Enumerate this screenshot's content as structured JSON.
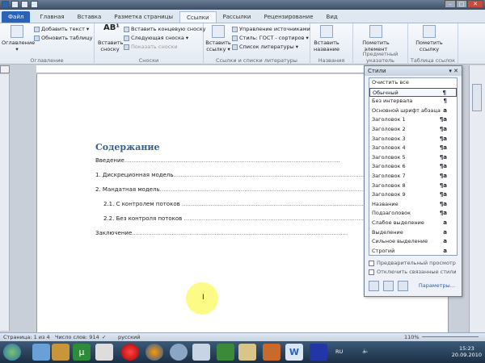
{
  "tabs": [
    "Файл",
    "Главная",
    "Вставка",
    "Разметка страницы",
    "Ссылки",
    "Рассылки",
    "Рецензирование",
    "Вид"
  ],
  "active_tab": "Ссылки",
  "ribbon": {
    "toc_group": {
      "label": "Оглавление",
      "big": "Оглавление",
      "add_text": "Добавить текст",
      "update_table": "Обновить таблицу"
    },
    "footnotes_group": {
      "label": "Сноски",
      "big": "Вставить сноску",
      "endnote": "Вставить концевую сноску",
      "next": "Следующая сноска",
      "show": "Показать сноски"
    },
    "citations_group": {
      "label": "Ссылки и списки литературы",
      "big": "Вставить ссылку",
      "manage": "Управление источниками",
      "style_label": "Стиль:",
      "style_value": "ГОСТ - сортиров",
      "bibliography": "Список литературы"
    },
    "captions_group": {
      "label": "Названия",
      "big": "Вставить название"
    },
    "index_group": {
      "label": "Предметный указатель",
      "big": "Пометить элемент"
    },
    "toa_group": {
      "label": "Таблица ссылок",
      "big": "Пометить ссылку"
    }
  },
  "document": {
    "title": "Содержание",
    "toc": [
      {
        "text": "Введение",
        "level": 1
      },
      {
        "text": "1. Дискреционная модель",
        "level": 1
      },
      {
        "text": "2. Мандатная модель",
        "level": 1
      },
      {
        "text": "2.1. С контролем потоков",
        "level": 2
      },
      {
        "text": "2.2. Без контроля потоков",
        "level": 2
      },
      {
        "text": "Заключение",
        "level": 1
      }
    ]
  },
  "styles_pane": {
    "title": "Стили",
    "items": [
      {
        "name": "Очистить все",
        "mark": ""
      },
      {
        "name": "Обычный",
        "mark": "¶",
        "selected": true
      },
      {
        "name": "Без интервала",
        "mark": "¶"
      },
      {
        "name": "Основной шрифт абзаца",
        "mark": "a"
      },
      {
        "name": "Заголовок 1",
        "mark": "¶a"
      },
      {
        "name": "Заголовок 2",
        "mark": "¶a"
      },
      {
        "name": "Заголовок 3",
        "mark": "¶a"
      },
      {
        "name": "Заголовок 4",
        "mark": "¶a"
      },
      {
        "name": "Заголовок 5",
        "mark": "¶a"
      },
      {
        "name": "Заголовок 6",
        "mark": "¶a"
      },
      {
        "name": "Заголовок 7",
        "mark": "¶a"
      },
      {
        "name": "Заголовок 8",
        "mark": "¶a"
      },
      {
        "name": "Заголовок 9",
        "mark": "¶a"
      },
      {
        "name": "Название",
        "mark": "¶a"
      },
      {
        "name": "Подзаголовок",
        "mark": "¶a"
      },
      {
        "name": "Слабое выделение",
        "mark": "a"
      },
      {
        "name": "Выделение",
        "mark": "a"
      },
      {
        "name": "Сильное выделение",
        "mark": "a"
      },
      {
        "name": "Строгий",
        "mark": "a"
      }
    ],
    "preview_label": "Предварительный просмотр",
    "linked_label": "Отключить связанные стили",
    "options_link": "Параметры..."
  },
  "status": {
    "page": "Страница: 1 из 4",
    "words": "Число слов: 914",
    "language": "русский",
    "zoom": "110%"
  },
  "tray": {
    "lang": "RU",
    "time": "15:23",
    "date": "20.09.2010"
  }
}
